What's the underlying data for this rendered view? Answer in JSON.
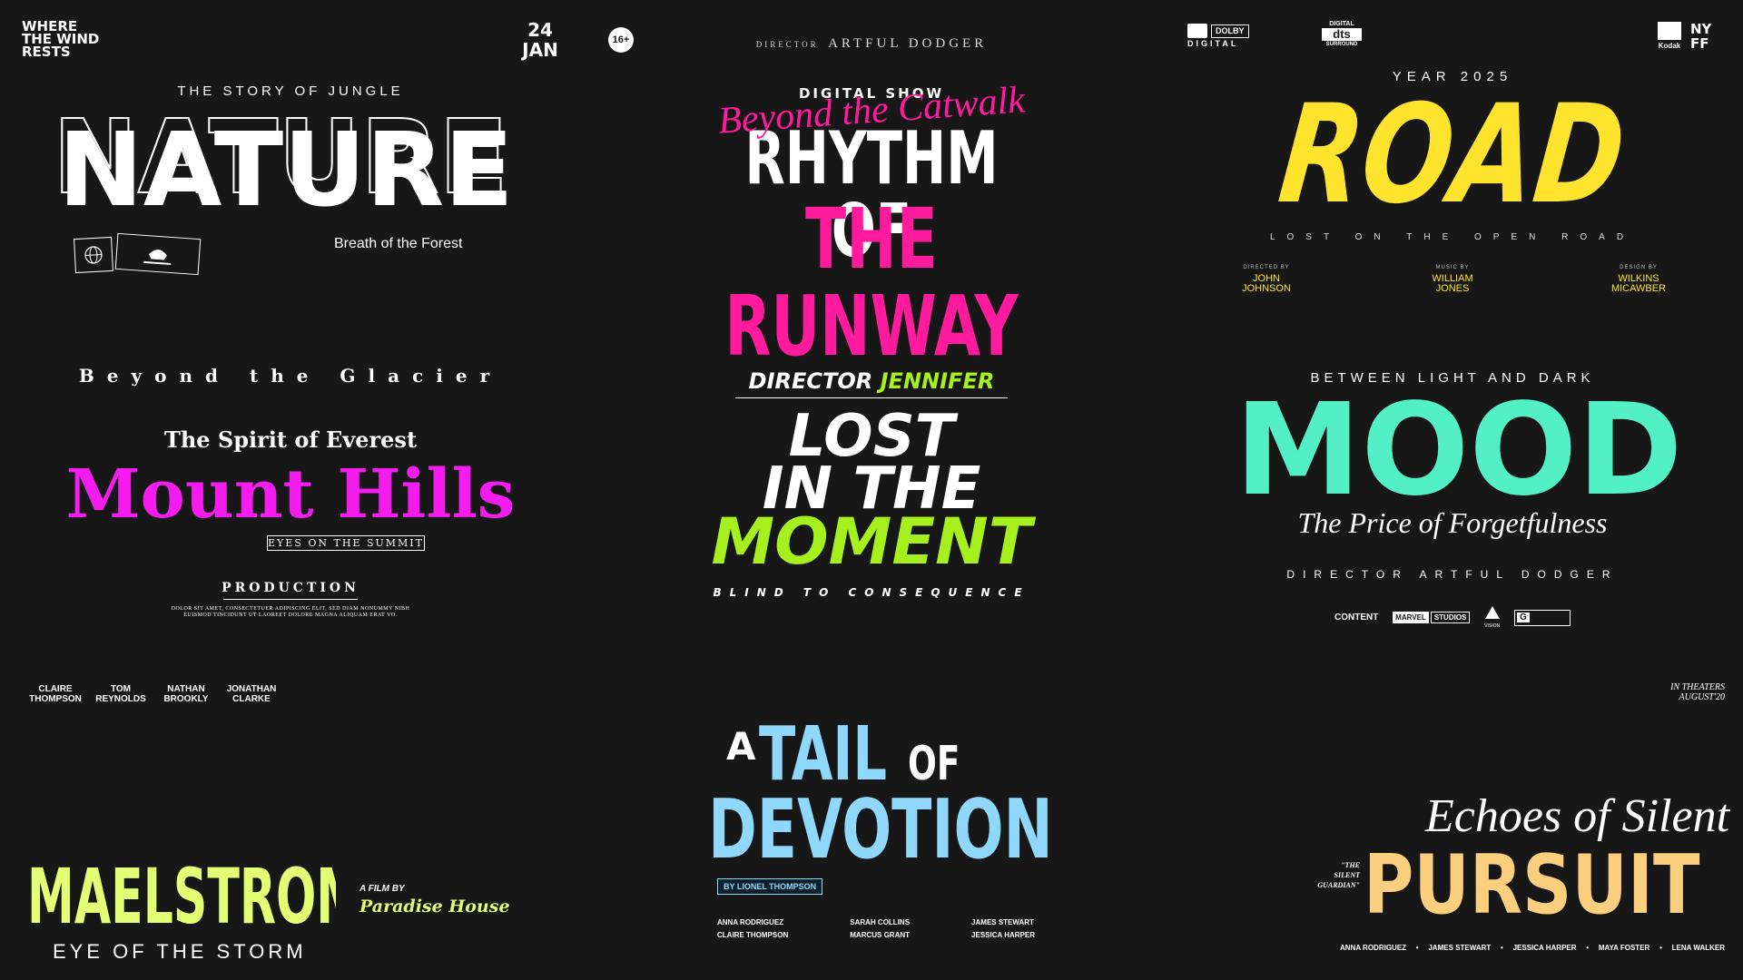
{
  "nature": {
    "corner_logo": [
      "WHERE",
      "THE WIND",
      "RESTS"
    ],
    "date_day": "24",
    "date_month": "JAN",
    "rating": "16+",
    "kicker": "THE STORY OF JUNGLE",
    "title": "NATURE",
    "subtitle": "Breath of the Forest"
  },
  "runway": {
    "director_prefix": "DIRECTOR",
    "director_name": "ARTFUL DODGER",
    "kicker": "DIGITAL SHOW",
    "script_overlay": "Beyond the Catwalk",
    "title_line1": "RHYTHM OF",
    "title_line2": "THE RUNWAY"
  },
  "road": {
    "dolby_top": "DOLBY",
    "dolby_bottom": "DIGITAL",
    "dts_top": "DIGITAL",
    "dts_mid": "dts",
    "dts_bottom": "SURROUND",
    "kodak": "Kodak",
    "nyff": "NY FF",
    "year_line": "YEAR 2025",
    "title": "ROAD",
    "tagline": "LOST ON THE OPEN ROAD",
    "credits": [
      {
        "role": "DIRECTED BY",
        "name1": "JOHN",
        "name2": "JOHNSON"
      },
      {
        "role": "MUSIC BY",
        "name1": "WILLIAM",
        "name2": "JONES"
      },
      {
        "role": "DESIGN BY",
        "name1": "WILKINS",
        "name2": "MICAWBER"
      }
    ]
  },
  "glacier": {
    "kicker": "Beyond the Glacier",
    "subtitle": "The Spirit of Everest",
    "title": "Mount Hills",
    "boxed_tag": "EYES ON THE SUMMIT",
    "production": "PRODUCTION",
    "lorem_line1": "DOLOR SIT AMET, CONSECTETUER ADIPISCING ELIT, SED DIAM NONUMMY NIBH",
    "lorem_line2": "EUISMOD TINCIDUNT UT LAOREET DOLORE MAGNA ALIQUAM ERAT VO."
  },
  "moment": {
    "director_label": "DIRECTOR",
    "director_name": "JENNIFER",
    "line1": "LOST",
    "line2": "IN THE",
    "line3": "MOMENT",
    "tagline": "BLIND TO CONSEQUENCE"
  },
  "mood": {
    "kicker": "BETWEEN LIGHT AND DARK",
    "title": "MOOD",
    "script": "The Price of Forgetfulness",
    "director_line": "DIRECTOR ARTFUL DODGER",
    "logos": [
      "CONTENT",
      "MARVEL",
      "STUDIOS",
      "VISION",
      "G"
    ]
  },
  "maelstrom": {
    "cast": [
      {
        "a": "CLAIRE",
        "b": "THOMPSON"
      },
      {
        "a": "TOM",
        "b": "REYNOLDS"
      },
      {
        "a": "NATHAN",
        "b": "BROOKLY"
      },
      {
        "a": "JONATHAN",
        "b": "CLARKE"
      }
    ],
    "title": "MAELSTROM",
    "subtitle": "EYE OF THE STORM",
    "film_by": "A FILM BY",
    "studio": "Paradise House"
  },
  "devotion": {
    "a": "A",
    "tail": "TAIL",
    "of": "OF",
    "title_line2": "DEVOTION",
    "byline": "BY LIONEL THOMPSON",
    "cast": [
      [
        "ANNA RODRIGUEZ",
        "CLAIRE THOMPSON"
      ],
      [
        "SARAH COLLINS",
        "MARCUS GRANT"
      ],
      [
        "JAMES STEWART",
        "JESSICA HARPER"
      ]
    ]
  },
  "pursuit": {
    "theaters_line1": "IN THEATERS",
    "theaters_line2": "AUGUST'20",
    "script_title": "Echoes of Silent",
    "quote": [
      "\"THE",
      "SILENT",
      "GUARDIAN\""
    ],
    "title": "PURSUIT",
    "cast": [
      "ANNA RODRIGUEZ",
      "JAMES STEWART",
      "JESSICA HARPER",
      "MAYA FOSTER",
      "LENA WALKER"
    ]
  },
  "colors": {
    "background": "#171717",
    "runway_pink": "#ff1a9e",
    "road_yellow": "#ffe42e",
    "glacier_magenta": "#f51cf0",
    "moment_lime": "#a6f01e",
    "mood_mint": "#52f0c4",
    "maelstrom_lime": "#e4ff73",
    "devotion_blue": "#8fd8fc",
    "pursuit_peach": "#fccf7e"
  }
}
